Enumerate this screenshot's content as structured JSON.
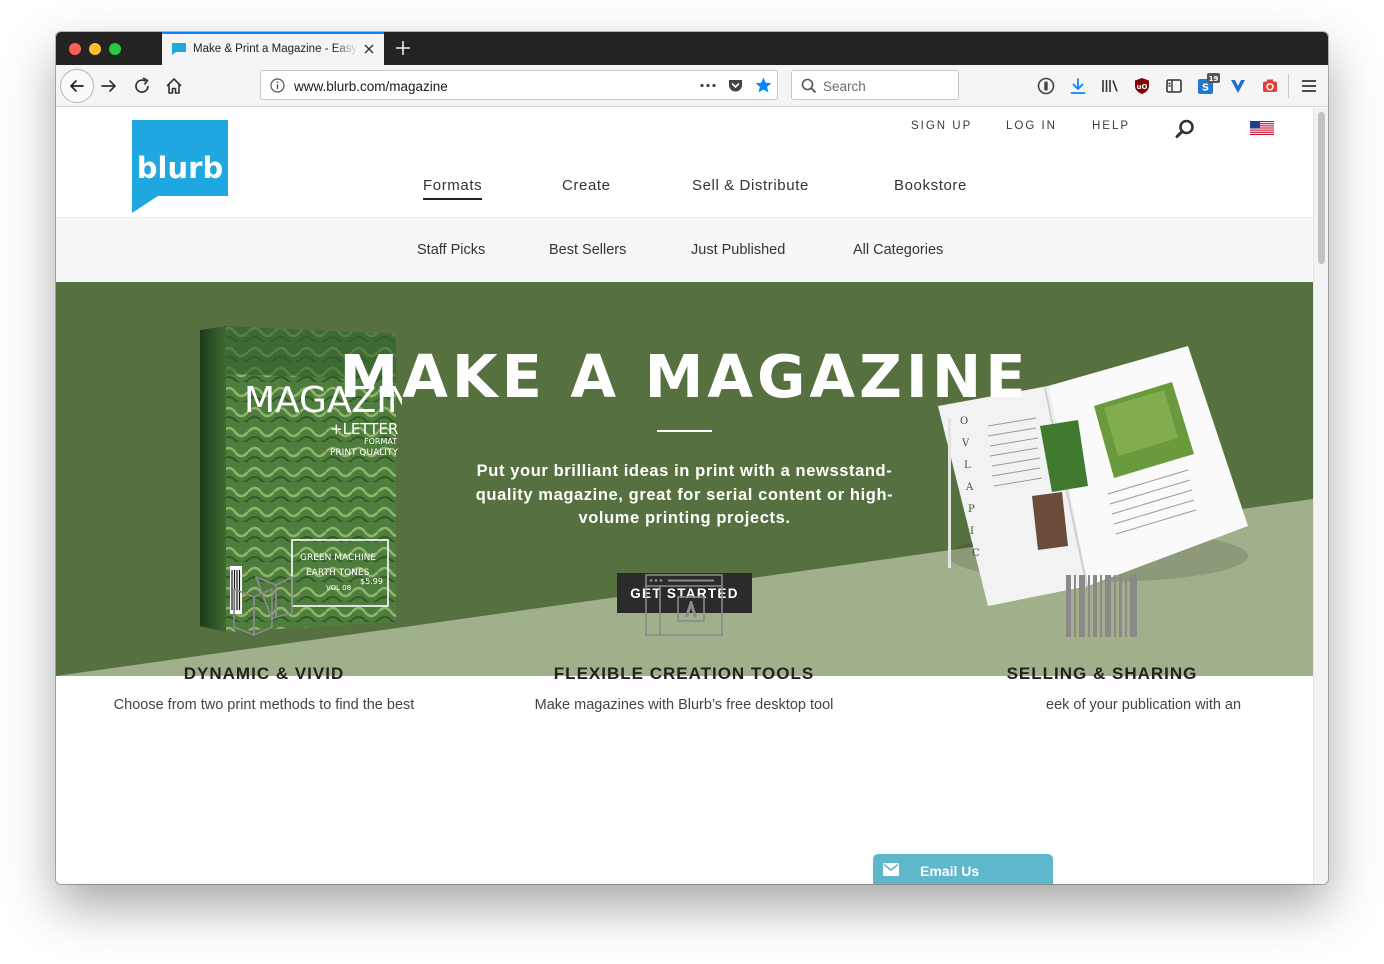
{
  "browser": {
    "tab_title": "Make & Print a Magazine - Easy",
    "url": "www.blurb.com/magazine",
    "search_placeholder": "Search",
    "badge_count": "19"
  },
  "site": {
    "logo_text": "blurb",
    "brand_color": "#1fa8e0",
    "util_links": [
      "SIGN UP",
      "LOG IN",
      "HELP"
    ],
    "main_nav": [
      "Formats",
      "Create",
      "Sell & Distribute",
      "Bookstore"
    ],
    "active_nav": "Formats",
    "sub_nav": [
      "Staff Picks",
      "Best Sellers",
      "Just Published",
      "All Categories"
    ]
  },
  "hero": {
    "title": "MAKE A MAGAZINE",
    "subtitle": "Put your brilliant ideas in print with a newsstand-quality magazine, great for serial content or high-volume printing projects.",
    "cta": "GET STARTED",
    "bg_dark": "#577040",
    "bg_light": "#a0b08a",
    "mag_cover": {
      "masthead": "MAGAZINE",
      "tag": "+LETTER",
      "format": "FORMAT",
      "quality": "PRINT QUALITY",
      "box": [
        "GREEN MACHINE",
        "EARTH TONES"
      ],
      "vol": "VOL 08",
      "price": "$5.99"
    }
  },
  "features": [
    {
      "title": "DYNAMIC & VIVID",
      "desc": "Choose from two print methods to find the best",
      "icon": "folded-page-icon"
    },
    {
      "title": "FLEXIBLE CREATION TOOLS",
      "desc": "Make magazines with Blurb’s free desktop tool",
      "icon": "adobe-window-icon"
    },
    {
      "title": "SELLING & SHARING",
      "desc": "eek of your publication with an",
      "icon": "barcode-icon"
    }
  ],
  "email_us": "Email Us"
}
